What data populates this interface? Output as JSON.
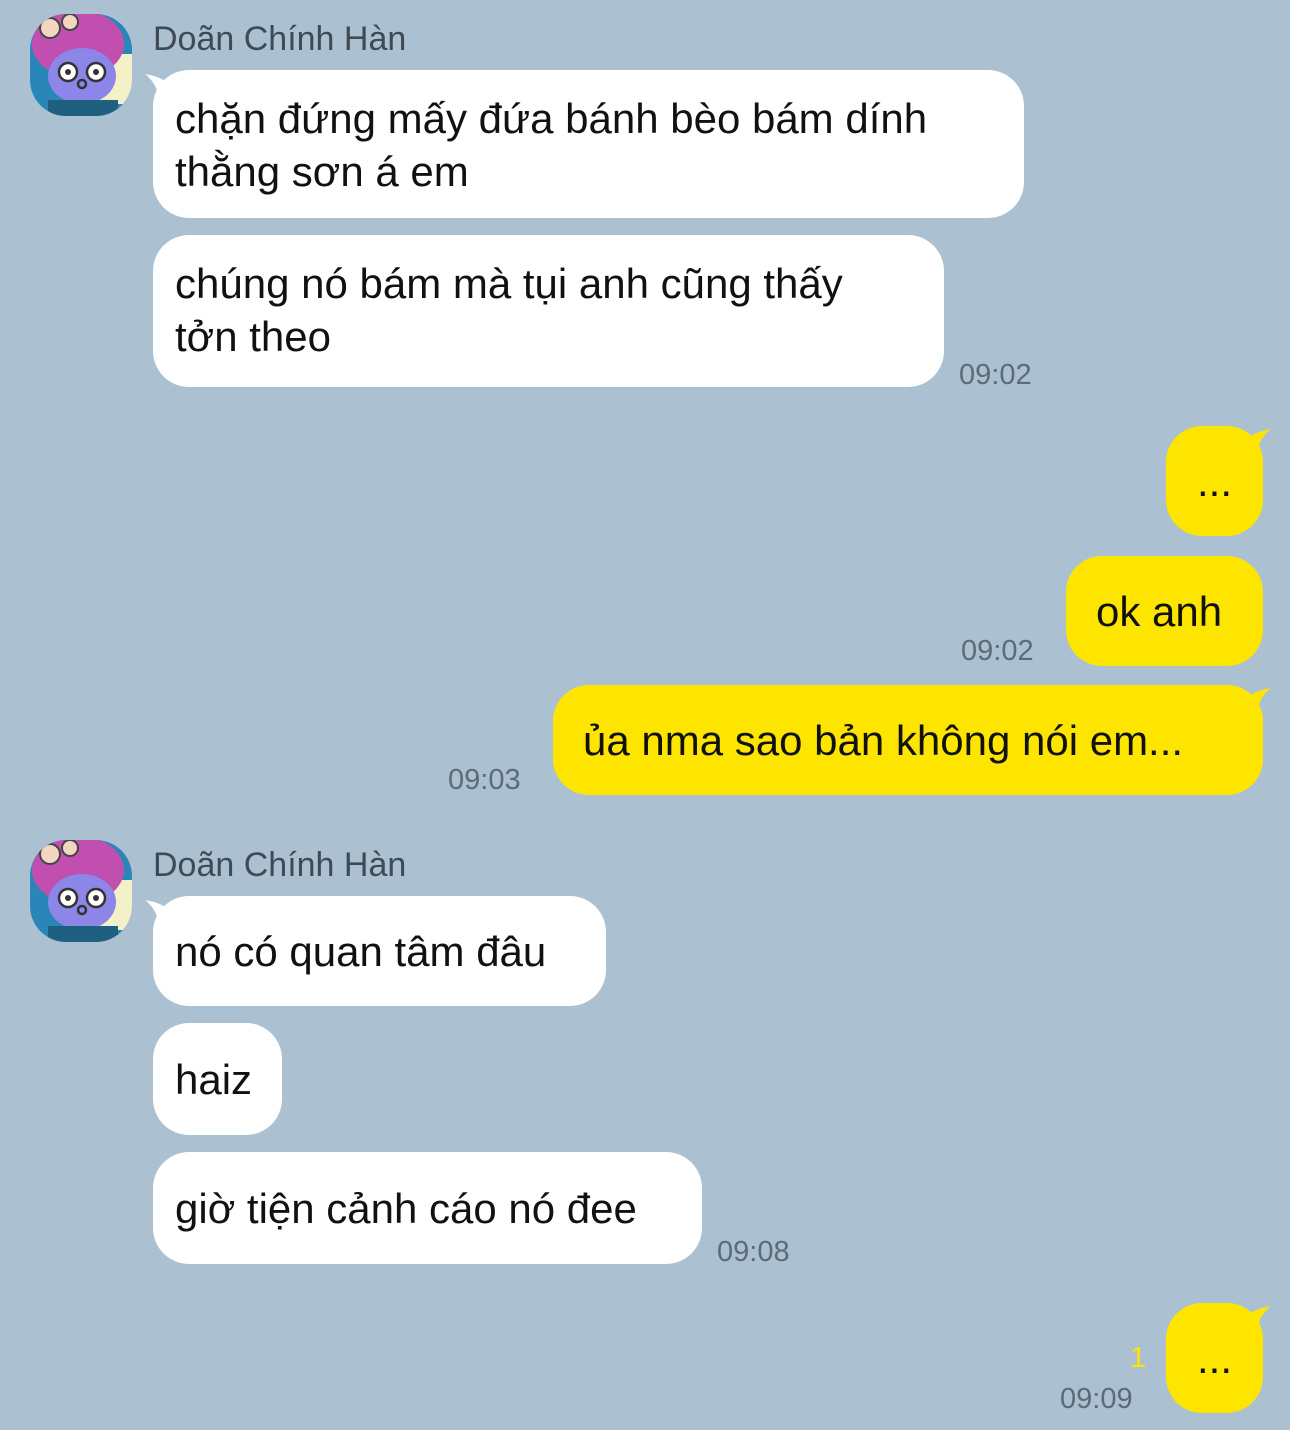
{
  "colors": {
    "background": "#abc1d1",
    "incoming_bubble": "#ffffff",
    "outgoing_bubble": "#fee500",
    "timestamp": "#5d6b78",
    "unread_count": "#fee500"
  },
  "groups": [
    {
      "sender": "Doãn Chính Hàn",
      "avatar_icon": "purple-bunny-avatar-icon",
      "messages": [
        {
          "lines": [
            "chặn đứng mấy đứa bánh bèo bám dính",
            "thằng sơn á em"
          ]
        },
        {
          "lines": [
            "chúng nó bám mà tụi anh cũng thấy",
            "tởn theo"
          ]
        }
      ],
      "time": "09:02"
    },
    {
      "sender": "Doãn Chính Hàn",
      "avatar_icon": "purple-bunny-avatar-icon",
      "messages": [
        {
          "text": "nó có quan tâm đâu"
        },
        {
          "text": "haiz"
        },
        {
          "text": "giờ tiện cảnh cáo nó đee"
        }
      ],
      "time": "09:08"
    }
  ],
  "outgoing": [
    {
      "text": "...",
      "time": ""
    },
    {
      "text": "ok anh",
      "time": "09:02"
    },
    {
      "text": "ủa nma sao bản không nói em...",
      "time": "09:03"
    },
    {
      "text": "...",
      "time": "09:09",
      "unread": "1"
    }
  ]
}
